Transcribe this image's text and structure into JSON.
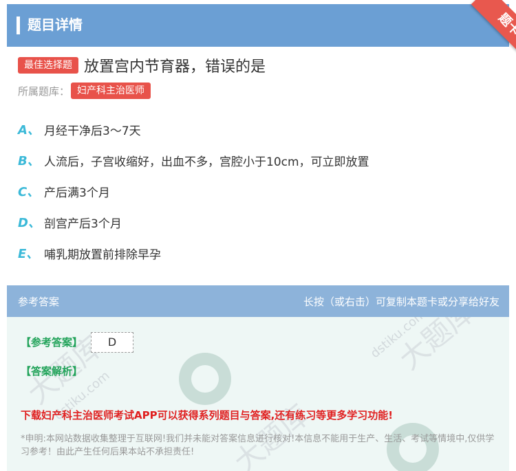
{
  "header": {
    "title": "题目详情"
  },
  "corner_badge": "题卡",
  "question": {
    "type_badge": "最佳选择题",
    "text": "放置宫内节育器，错误的是",
    "bank_label": "所属题库：",
    "bank_name": "妇产科主治医师"
  },
  "options": [
    {
      "letter": "A、",
      "text": "月经干净后3～7天"
    },
    {
      "letter": "B、",
      "text": "人流后，子宫收缩好，出血不多，宫腔小于10cm，可立即放置"
    },
    {
      "letter": "C、",
      "text": "产后满3个月"
    },
    {
      "letter": "D、",
      "text": "剖宫产后3个月"
    },
    {
      "letter": "E、",
      "text": "哺乳期放置前排除早孕"
    }
  ],
  "answer_panel": {
    "title": "参考答案",
    "hint": "长按（或右击）可复制本题卡或分享给好友",
    "answer_label": "【参考答案】",
    "answer_value": "D",
    "explanation_label": "【答案解析】",
    "promo": "下载妇产科主治医师考试APP可以获得系列题目与答案,还有练习等更多学习功能!",
    "disclaimer": "*申明:本网站数据收集整理于互联网!我们并未能对答案信息进行核对!本信息不能用于生产、生活、考试等情境中,仅供学习参考！由此产生任何后果本站不承担责任!"
  },
  "watermark": {
    "text": "大题库",
    "url": "dstiku.com"
  },
  "colors": {
    "header": "#6b9fd4",
    "accent_red": "#e8524a",
    "option_letter": "#3bb9d8",
    "answer_green": "#22a35a"
  }
}
